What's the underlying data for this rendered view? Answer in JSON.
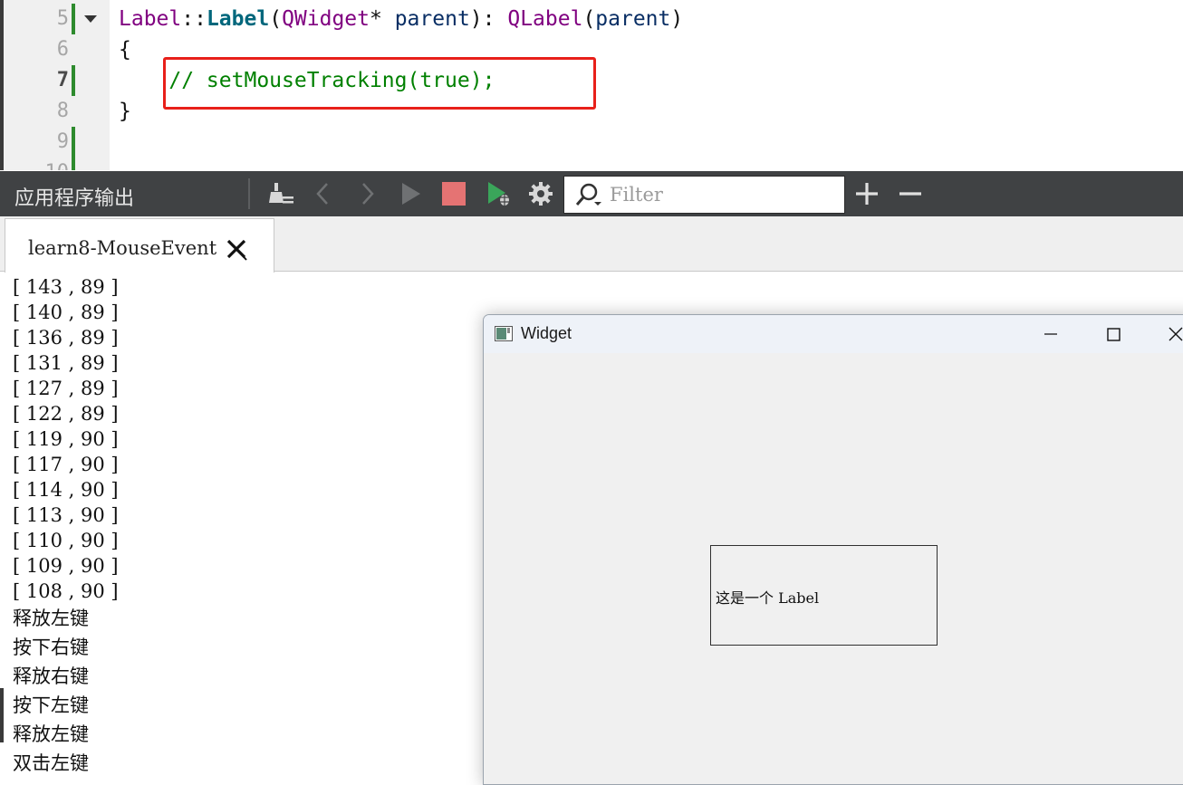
{
  "editor": {
    "lines": [
      {
        "num": "5",
        "tokens": [
          {
            "text": "Label",
            "cls": "t-type"
          },
          {
            "text": "::",
            "cls": "t-plain"
          },
          {
            "text": "Label",
            "cls": "t-func"
          },
          {
            "text": "(",
            "cls": "t-plain"
          },
          {
            "text": "QWidget",
            "cls": "t-type"
          },
          {
            "text": "* ",
            "cls": "t-plain"
          },
          {
            "text": "parent",
            "cls": "t-name"
          },
          {
            "text": "): ",
            "cls": "t-plain"
          },
          {
            "text": "QLabel",
            "cls": "t-type"
          },
          {
            "text": "(",
            "cls": "t-plain"
          },
          {
            "text": "parent",
            "cls": "t-name"
          },
          {
            "text": ")",
            "cls": "t-plain"
          }
        ]
      },
      {
        "num": "6",
        "tokens": [
          {
            "text": "{",
            "cls": "t-plain"
          }
        ]
      },
      {
        "num": "7",
        "tokens": [
          {
            "text": "    // setMouseTracking(true);",
            "cls": "t-cmt"
          }
        ]
      },
      {
        "num": "8",
        "tokens": [
          {
            "text": "}",
            "cls": "t-plain"
          }
        ]
      },
      {
        "num": "9",
        "tokens": []
      },
      {
        "num": "10",
        "tokens": []
      }
    ]
  },
  "toolbar": {
    "title": "应用程序输出",
    "filter_placeholder": "Filter",
    "icons": [
      "clean-icon",
      "prev-icon",
      "next-icon",
      "run-icon",
      "stop-icon",
      "debug-run-icon",
      "settings-icon",
      "search-icon",
      "plus-icon",
      "minus-icon"
    ],
    "stop_color": "#e57373",
    "debug_color": "#3aa55a"
  },
  "tab": {
    "label": "learn8-MouseEvent"
  },
  "output": {
    "coords": [
      "[ 143 , 89 ]",
      "[ 140 , 89 ]",
      "[ 136 , 89 ]",
      "[ 131 , 89 ]",
      "[ 127 , 89 ]",
      "[ 122 , 89 ]",
      "[ 119 , 90 ]",
      "[ 117 , 90 ]",
      "[ 114 , 90 ]",
      "[ 113 , 90 ]",
      "[ 110 , 90 ]",
      "[ 109 , 90 ]",
      "[ 108 , 90 ]"
    ],
    "events": [
      "释放左键",
      "按下右键",
      "释放右键",
      "按下左键",
      "释放左键",
      "双击左键"
    ]
  },
  "widget": {
    "title": "Widget",
    "label_text": "这是一个 Label"
  },
  "colors": {
    "comment": "#008000",
    "highlight_box": "#e8201a",
    "change_marker": "#2e8b2e"
  }
}
